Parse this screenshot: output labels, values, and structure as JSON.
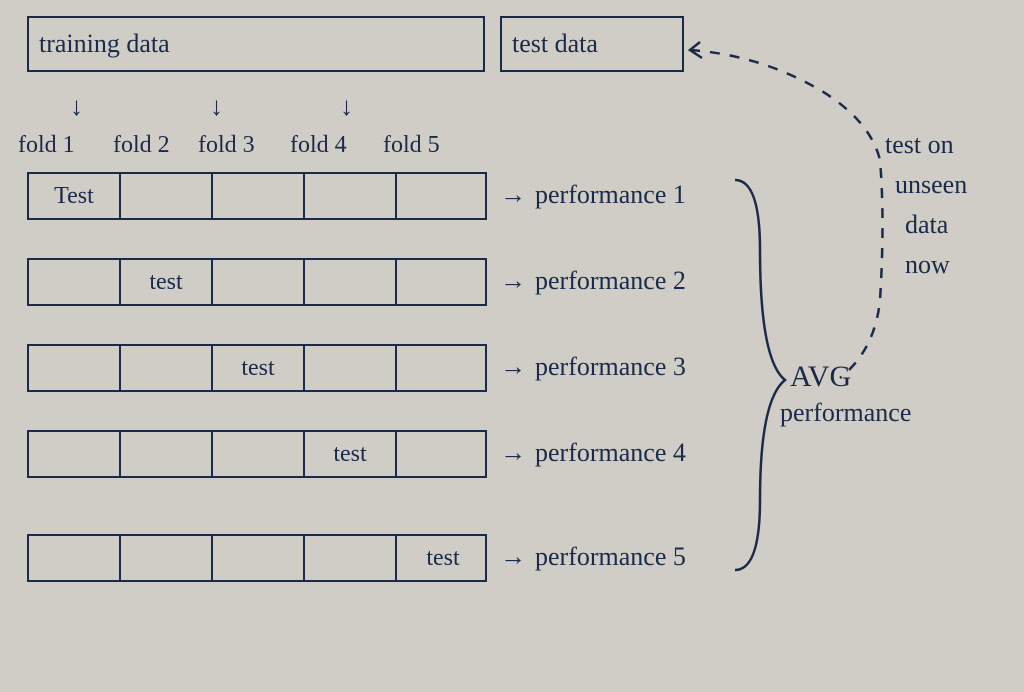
{
  "header": {
    "training": "training data",
    "test": "test data"
  },
  "fold_labels": [
    "fold 1",
    "fold 2",
    "fold 3",
    "fold 4",
    "fold 5"
  ],
  "rows": [
    {
      "test_index": 0,
      "cells": [
        "Test",
        "",
        "",
        "",
        ""
      ],
      "perf": "performance 1"
    },
    {
      "test_index": 1,
      "cells": [
        "",
        "test",
        "",
        "",
        ""
      ],
      "perf": "performance 2"
    },
    {
      "test_index": 2,
      "cells": [
        "",
        "",
        "test",
        "",
        ""
      ],
      "perf": "performance 3"
    },
    {
      "test_index": 3,
      "cells": [
        "",
        "",
        "",
        "test",
        ""
      ],
      "perf": "performance 4"
    },
    {
      "test_index": 4,
      "cells": [
        "",
        "",
        "",
        "",
        "test"
      ],
      "perf": "performance 5"
    }
  ],
  "avg_label_top": "AVG",
  "avg_label_bottom": "performance",
  "side_note": [
    "test on",
    "unseen",
    "data",
    "now"
  ],
  "arrow_glyph": "→",
  "down_arrow_glyph": "↓"
}
